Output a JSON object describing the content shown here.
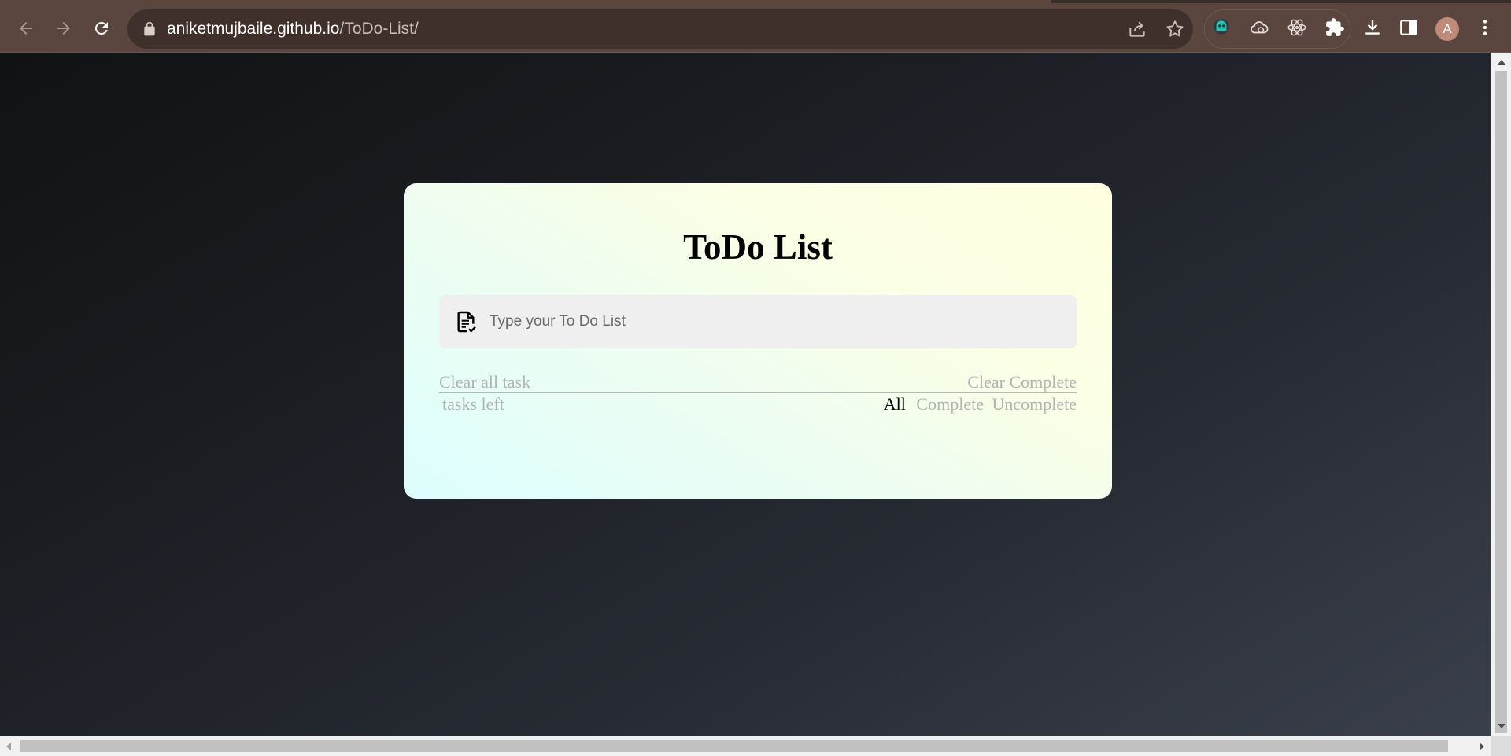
{
  "browser": {
    "url_host": "aniketmujbaile.github.io",
    "url_path": "/ToDo-List/",
    "profile_initial": "A",
    "icons": {
      "back": "arrow-left-icon",
      "forward": "arrow-right-icon",
      "reload": "reload-icon",
      "lock": "lock-icon",
      "share": "share-icon",
      "bookmark": "star-icon",
      "extensions": [
        "ghost-extension-icon",
        "cloud-extension-icon",
        "react-devtools-icon",
        "puzzle-icon"
      ],
      "download": "download-icon",
      "side_panel": "side-panel-icon",
      "menu": "kebab-menu-icon"
    }
  },
  "app": {
    "title": "ToDo List",
    "input": {
      "placeholder": "Type your To Do List",
      "value": ""
    },
    "clear_all_label": "Clear all task",
    "clear_complete_label": "Clear Complete",
    "tasks_left_label": " tasks left",
    "filters": {
      "all": "All",
      "complete": "Complete",
      "uncomplete": "Uncomplete",
      "active": "all"
    },
    "colors": {
      "muted_text": "#b3b3b3",
      "active_filter": "#000000"
    }
  }
}
